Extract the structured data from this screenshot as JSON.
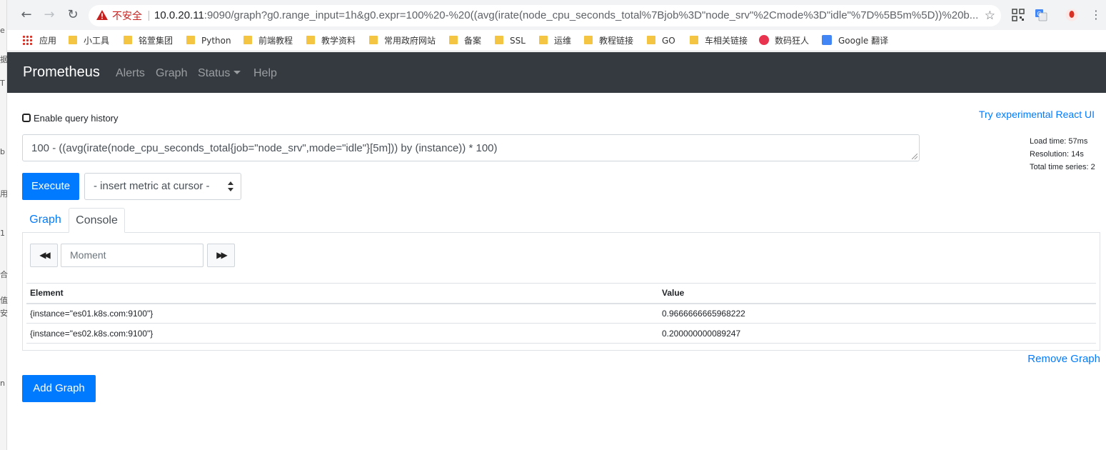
{
  "browser": {
    "back_icon": "←",
    "forward_icon": "→",
    "reload_icon": "↻",
    "insecure_label": "不安全",
    "url_host": "10.0.20.11",
    "url_rest": ":9090/graph?g0.range_input=1h&g0.expr=100%20-%20((avg(irate(node_cpu_seconds_total%7Bjob%3D\"node_srv\"%2Cmode%3D\"idle\"%7D%5B5m%5D))%20b...",
    "star_icon": "☆",
    "menu_icon": "⋮"
  },
  "bookmarks": [
    {
      "label": "应用"
    },
    {
      "label": "小工具"
    },
    {
      "label": "铭萱集团"
    },
    {
      "label": "Python"
    },
    {
      "label": "前端教程"
    },
    {
      "label": "教学资料"
    },
    {
      "label": "常用政府网站"
    },
    {
      "label": "备案"
    },
    {
      "label": "SSL"
    },
    {
      "label": "运维"
    },
    {
      "label": "教程链接"
    },
    {
      "label": "GO"
    },
    {
      "label": "车相关链接"
    },
    {
      "label": "数码狂人"
    },
    {
      "label": "Google 翻译"
    }
  ],
  "navbar": {
    "brand": "Prometheus",
    "links": [
      "Alerts",
      "Graph",
      "Status",
      "Help"
    ]
  },
  "query": {
    "history_label": "Enable query history",
    "react_ui_link": "Try experimental React UI",
    "expression": "100 - ((avg(irate(node_cpu_seconds_total{job=\"node_srv\",mode=\"idle\"}[5m])) by (instance)) * 100)",
    "load_time": "Load time: 57ms",
    "resolution": "Resolution: 14s",
    "total_series": "Total time series: 2",
    "execute_label": "Execute",
    "metric_select": "- insert metric at cursor -"
  },
  "tabs": [
    "Graph",
    "Console"
  ],
  "console": {
    "moment_placeholder": "Moment",
    "back_icon": "◀◀",
    "forward_icon": "▶▶",
    "columns": [
      "Element",
      "Value"
    ],
    "rows": [
      {
        "element": "{instance=\"es01.k8s.com:9100\"}",
        "value": "0.9666666665968222"
      },
      {
        "element": "{instance=\"es02.k8s.com:9100\"}",
        "value": "0.200000000089247"
      }
    ]
  },
  "remove_graph_label": "Remove Graph",
  "add_graph_label": "Add Graph",
  "left_sliver_chars": [
    "e",
    "据",
    "T",
    "b",
    "用",
    "1",
    "合",
    "值",
    "安",
    "n"
  ],
  "colors": {
    "navbar_bg": "#343a40",
    "primary": "#007bff",
    "insecure": "#c5221f"
  }
}
